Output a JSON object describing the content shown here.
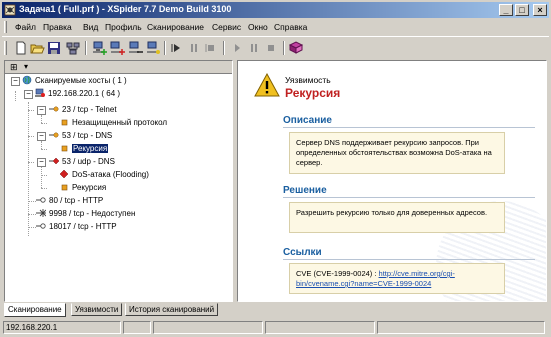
{
  "window": {
    "title": "Задача1 ( Full.prf ) - XSpider 7.7 Demo Build 3100",
    "controls": {
      "minimize": "_",
      "maximize": "□",
      "close": "×"
    }
  },
  "menu": [
    "Файл",
    "Правка",
    "Вид",
    "Профиль",
    "Сканирование",
    "Сервис",
    "Окно",
    "Справка"
  ],
  "toolbar_icons": [
    "new-icon",
    "open-icon",
    "save-icon",
    "scan-all-icon",
    "add-host-icon",
    "add-hosts-icon",
    "remove-host-icon",
    "network-icon",
    "start-icon",
    "pause-icon",
    "stop-icon",
    "play-icon",
    "pause2-icon",
    "stop2-icon",
    "book-icon"
  ],
  "left_header": {
    "plus": "⊞",
    "arrow": "▾"
  },
  "tree": {
    "root": "Сканируемые хосты ( 1 )",
    "host": "192.168.220.1 ( 64 )",
    "items": [
      {
        "label": "23 / tcp - Telnet",
        "type": "port-open"
      },
      {
        "label": "Незащищенный протокол",
        "type": "info"
      },
      {
        "label": "53 / tcp - DNS",
        "type": "port-open"
      },
      {
        "label": "Рекурсия",
        "type": "info"
      },
      {
        "label": "53 / udp - DNS",
        "type": "port-vuln"
      },
      {
        "label": "DoS-атака (Flooding)",
        "type": "vuln"
      },
      {
        "label": "Рекурсия",
        "type": "info"
      },
      {
        "label": "80 / tcp - HTTP",
        "type": "port"
      },
      {
        "label": "9998 / tcp - Недоступен",
        "type": "port-closed"
      },
      {
        "label": "18017 / tcp - HTTP",
        "type": "port"
      }
    ]
  },
  "detail": {
    "caption": "Уязвимость",
    "title": "Рекурсия",
    "description_heading": "Описание",
    "description_text": "Сервер DNS поддерживает рекурсию запросов. При определенных обстоятельствах возможна DoS-атака на сервер.",
    "solution_heading": "Решение",
    "solution_text": "Разрешить рекурсию только для доверенных адресов.",
    "links_heading": "Ссылки",
    "links_prefix": "CVE (CVE-1999-0024) : ",
    "links_url": "http://cve.mitre.org/cgi-bin/cvename.cgi?name=CVE-1999-0024"
  },
  "tabs": [
    "Сканирование",
    "Уязвимости",
    "История сканирований"
  ],
  "status": {
    "ip": "192.168.220.1",
    "panel2": "",
    "panel3": "",
    "panel4": "",
    "panel5": ""
  },
  "colors": {
    "title_start": "#0a246a",
    "title_end": "#a6caf0",
    "vuln_title": "#c02020",
    "section": "#1a5fa0",
    "selection": "#0a246a"
  }
}
